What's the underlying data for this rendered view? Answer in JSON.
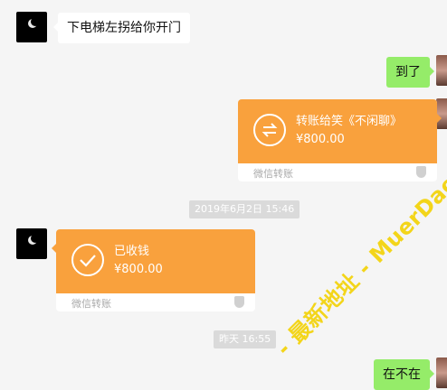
{
  "messages": {
    "m1": "下电梯左拐给你开门",
    "m2": "到了",
    "transfer_out": {
      "title": "转账给笑《不闲聊》",
      "amount": "¥800.00",
      "footer": "微信转账"
    },
    "timestamp1": "2019年6月2日 15:46",
    "transfer_in": {
      "title": "已收钱",
      "amount": "¥800.00",
      "footer": "微信转账"
    },
    "timestamp2": "昨天 16:55",
    "m3": "在不在"
  },
  "watermark": "- 最新地址 - MuerDaohang.Com",
  "colors": {
    "bubble_green": "#95ec69",
    "transfer_orange": "#f9a13d",
    "watermark": "#f3d51a"
  }
}
